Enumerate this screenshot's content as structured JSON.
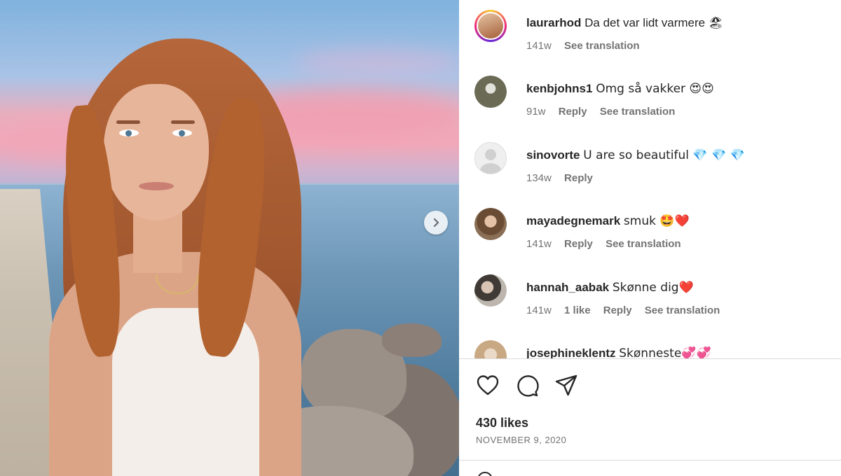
{
  "post": {
    "author": "laurarhod",
    "caption": "Da det var lidt varmere 🏖",
    "age": "141w",
    "translate_label": "See translation",
    "likes": "430 likes",
    "date": "NOVEMBER 9, 2020"
  },
  "comments": [
    {
      "user": "kenbjohns1",
      "text": "Omg så vakker 😍😍",
      "age": "91w",
      "likes": "",
      "reply": "Reply",
      "translate": "See translation",
      "avatar_color": "#6b6a55"
    },
    {
      "user": "sinovorte",
      "text": "U are so beautiful 💎 💎 💎",
      "age": "134w",
      "likes": "",
      "reply": "Reply",
      "translate": "",
      "avatar_color": "#d9d9d9"
    },
    {
      "user": "mayadegnemark",
      "text": "smuk 🤩❤️",
      "age": "141w",
      "likes": "",
      "reply": "Reply",
      "translate": "See translation",
      "avatar_color": "#8a6e55"
    },
    {
      "user": "hannah_aabak",
      "text": "Skønne dig❤️",
      "age": "141w",
      "likes": "1 like",
      "reply": "Reply",
      "translate": "See translation",
      "avatar_color": "#7a7570"
    },
    {
      "user": "josephineklentz",
      "text": "Skønneste💞💞",
      "age": "",
      "likes": "",
      "reply": "",
      "translate": "",
      "avatar_color": "#c9a984"
    }
  ],
  "colors": {
    "text": "#262626",
    "secondary": "#737373",
    "divider": "#dbdbdb"
  },
  "icons": {
    "like": "heart-icon",
    "comment": "comment-bubble-icon",
    "share": "paper-plane-icon",
    "next": "chevron-right-icon"
  }
}
